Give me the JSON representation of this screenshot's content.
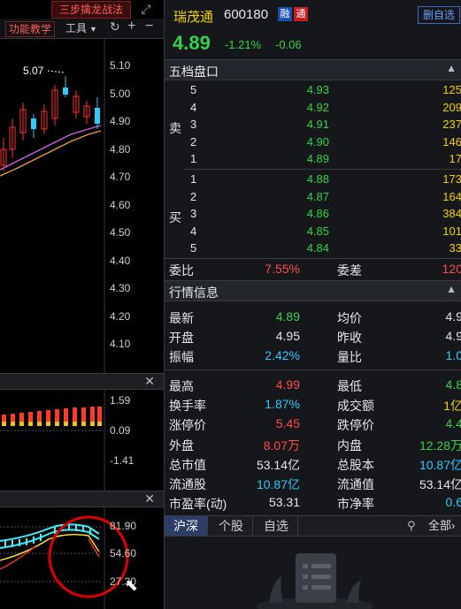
{
  "left_toolbar": {
    "strategy_button": "三步擒龙战法",
    "tutorial_button": "功能教学",
    "tools_button": "工具"
  },
  "price_axis": [
    "5.10",
    "5.00",
    "4.90",
    "4.80",
    "4.70",
    "4.60",
    "4.50",
    "4.40",
    "4.30",
    "4.20",
    "4.10"
  ],
  "high_marker": "5.07",
  "volume_axis": [
    "1.59",
    "0.09",
    "-1.41"
  ],
  "indicator_axis": [
    "81.90",
    "54.60",
    "27.30"
  ],
  "header": {
    "stock_name": "瑞茂通",
    "stock_code": "600180",
    "badge_margin": "融",
    "badge_tong": "通",
    "watchlist_button": "删自选",
    "price": "4.89",
    "change_pct": "-1.21%",
    "change": "-0.06"
  },
  "order_book": {
    "title": "五档盘口",
    "sell_label": "卖",
    "buy_label": "买",
    "sells": [
      {
        "level": "5",
        "price": "4.93",
        "volume": "125"
      },
      {
        "level": "4",
        "price": "4.92",
        "volume": "209"
      },
      {
        "level": "3",
        "price": "4.91",
        "volume": "237"
      },
      {
        "level": "2",
        "price": "4.90",
        "volume": "146"
      },
      {
        "level": "1",
        "price": "4.89",
        "volume": "17"
      }
    ],
    "buys": [
      {
        "level": "1",
        "price": "4.88",
        "volume": "173"
      },
      {
        "level": "2",
        "price": "4.87",
        "volume": "164"
      },
      {
        "level": "3",
        "price": "4.86",
        "volume": "384"
      },
      {
        "level": "4",
        "price": "4.85",
        "volume": "101"
      },
      {
        "level": "5",
        "price": "4.84",
        "volume": "33"
      }
    ],
    "weibi_label": "委比",
    "weibi_value": "7.55%",
    "weicha_label": "委差",
    "weicha_value": "120"
  },
  "market_info": {
    "title": "行情信息",
    "rows": [
      {
        "l1": "最新",
        "v1": "4.89",
        "l2": "均价",
        "v2": "4.9"
      },
      {
        "l1": "开盘",
        "v1": "4.95",
        "l2": "昨收",
        "v2": "4.9"
      },
      {
        "l1": "振幅",
        "v1": "2.42%",
        "l2": "量比",
        "v2": "1.0"
      },
      {
        "l1": "最高",
        "v1": "4.99",
        "l2": "最低",
        "v2": "4.8"
      },
      {
        "l1": "换手率",
        "v1": "1.87%",
        "l2": "成交额",
        "v2": "1亿"
      },
      {
        "l1": "涨停价",
        "v1": "5.45",
        "l2": "跌停价",
        "v2": "4.4"
      },
      {
        "l1": "外盘",
        "v1": "8.07万",
        "l2": "内盘",
        "v2": "12.28万"
      },
      {
        "l1": "总市值",
        "v1": "53.14亿",
        "l2": "总股本",
        "v2": "10.87亿"
      },
      {
        "l1": "流通股",
        "v1": "10.87亿",
        "l2": "流通值",
        "v2": "53.14亿"
      },
      {
        "l1": "市盈率(动)",
        "v1": "53.31",
        "l2": "市净率",
        "v2": "0.6"
      }
    ]
  },
  "bottom_tabs": {
    "tab1": "沪深",
    "tab2": "个股",
    "tab3": "自选",
    "all": "全部"
  },
  "colors": {
    "up": "#ff4a4a",
    "down": "#35d14a",
    "flat": "#e6e6e6",
    "accent": "#2fc8ff"
  }
}
